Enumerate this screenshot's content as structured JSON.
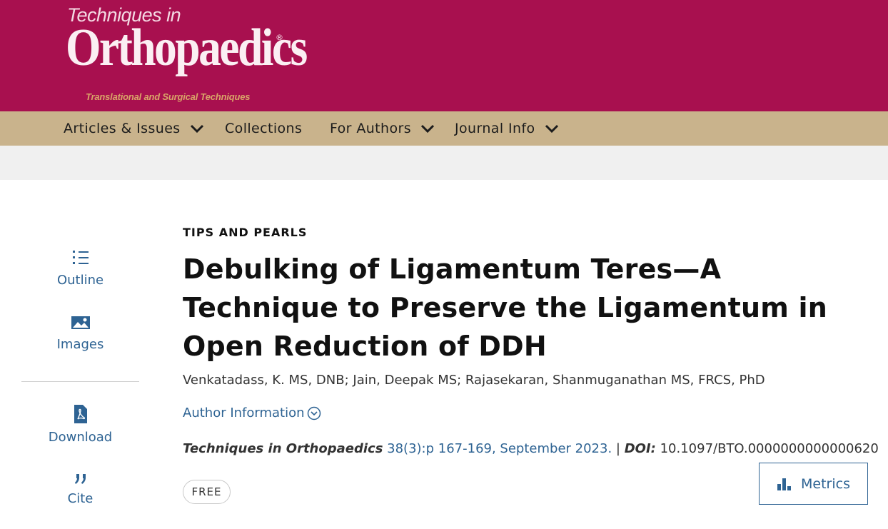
{
  "journal": {
    "name_line1": "Techniques in",
    "name_main": "Orthopaedics",
    "registered": "®",
    "tagline": "Translational and Surgical Techniques"
  },
  "nav": {
    "items": [
      {
        "label": "Articles & Issues",
        "has_dropdown": true
      },
      {
        "label": "Collections",
        "has_dropdown": false
      },
      {
        "label": "For Authors",
        "has_dropdown": true
      },
      {
        "label": "Journal Info",
        "has_dropdown": true
      }
    ]
  },
  "sidebar": {
    "outline_label": "Outline",
    "images_label": "Images",
    "download_label": "Download",
    "cite_label": "Cite"
  },
  "article": {
    "section": "TIPS AND PEARLS",
    "title": "Debulking of Ligamentum Teres—A Technique to Preserve the Ligamentum in Open Reduction of DDH",
    "authors": "Venkatadass, K. MS, DNB; Jain, Deepak MS; Rajasekaran, Shanmuganathan MS, FRCS, PhD",
    "author_info_label": "Author Information",
    "journal_name": "Techniques in Orthopaedics",
    "volume_pages": "38(3):p 167-169, September 2023.",
    "separator": "|",
    "doi_label": "DOI:",
    "doi": "10.1097/BTO.0000000000000620",
    "access_badge": "FREE"
  },
  "metrics_label": "Metrics",
  "colors": {
    "masthead": "#a8104f",
    "nav_bar": "#c9b38c",
    "link": "#2e6393",
    "band": "#f0f0f0"
  }
}
